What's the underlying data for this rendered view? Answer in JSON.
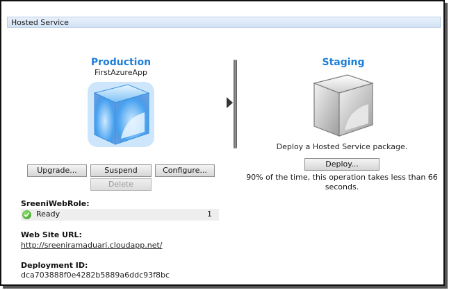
{
  "panel": {
    "title": "Hosted Service"
  },
  "production": {
    "title": "Production",
    "app_name": "FirstAzureApp",
    "buttons": {
      "upgrade": "Upgrade...",
      "suspend": "Suspend",
      "configure": "Configure...",
      "delete": "Delete"
    },
    "role": {
      "name": "SreeniWebRole:",
      "status": "Ready",
      "instances": "1"
    },
    "website": {
      "label": "Web Site URL:",
      "url": "http://sreeniramaduari.cloudapp.net/"
    },
    "deployment": {
      "label": "Deployment ID:",
      "id": "dca703888f0e4282b5889a6ddc93f8bc"
    }
  },
  "staging": {
    "title": "Staging",
    "description": "Deploy a Hosted Service package.",
    "deploy_button": "Deploy...",
    "note": "90% of the time, this operation takes less than 66 seconds."
  },
  "colors": {
    "accent": "#1f7fd8",
    "cube_production": "#4aa3f0",
    "cube_staging": "#bfbfbf",
    "ready_icon": "#3cae23"
  }
}
